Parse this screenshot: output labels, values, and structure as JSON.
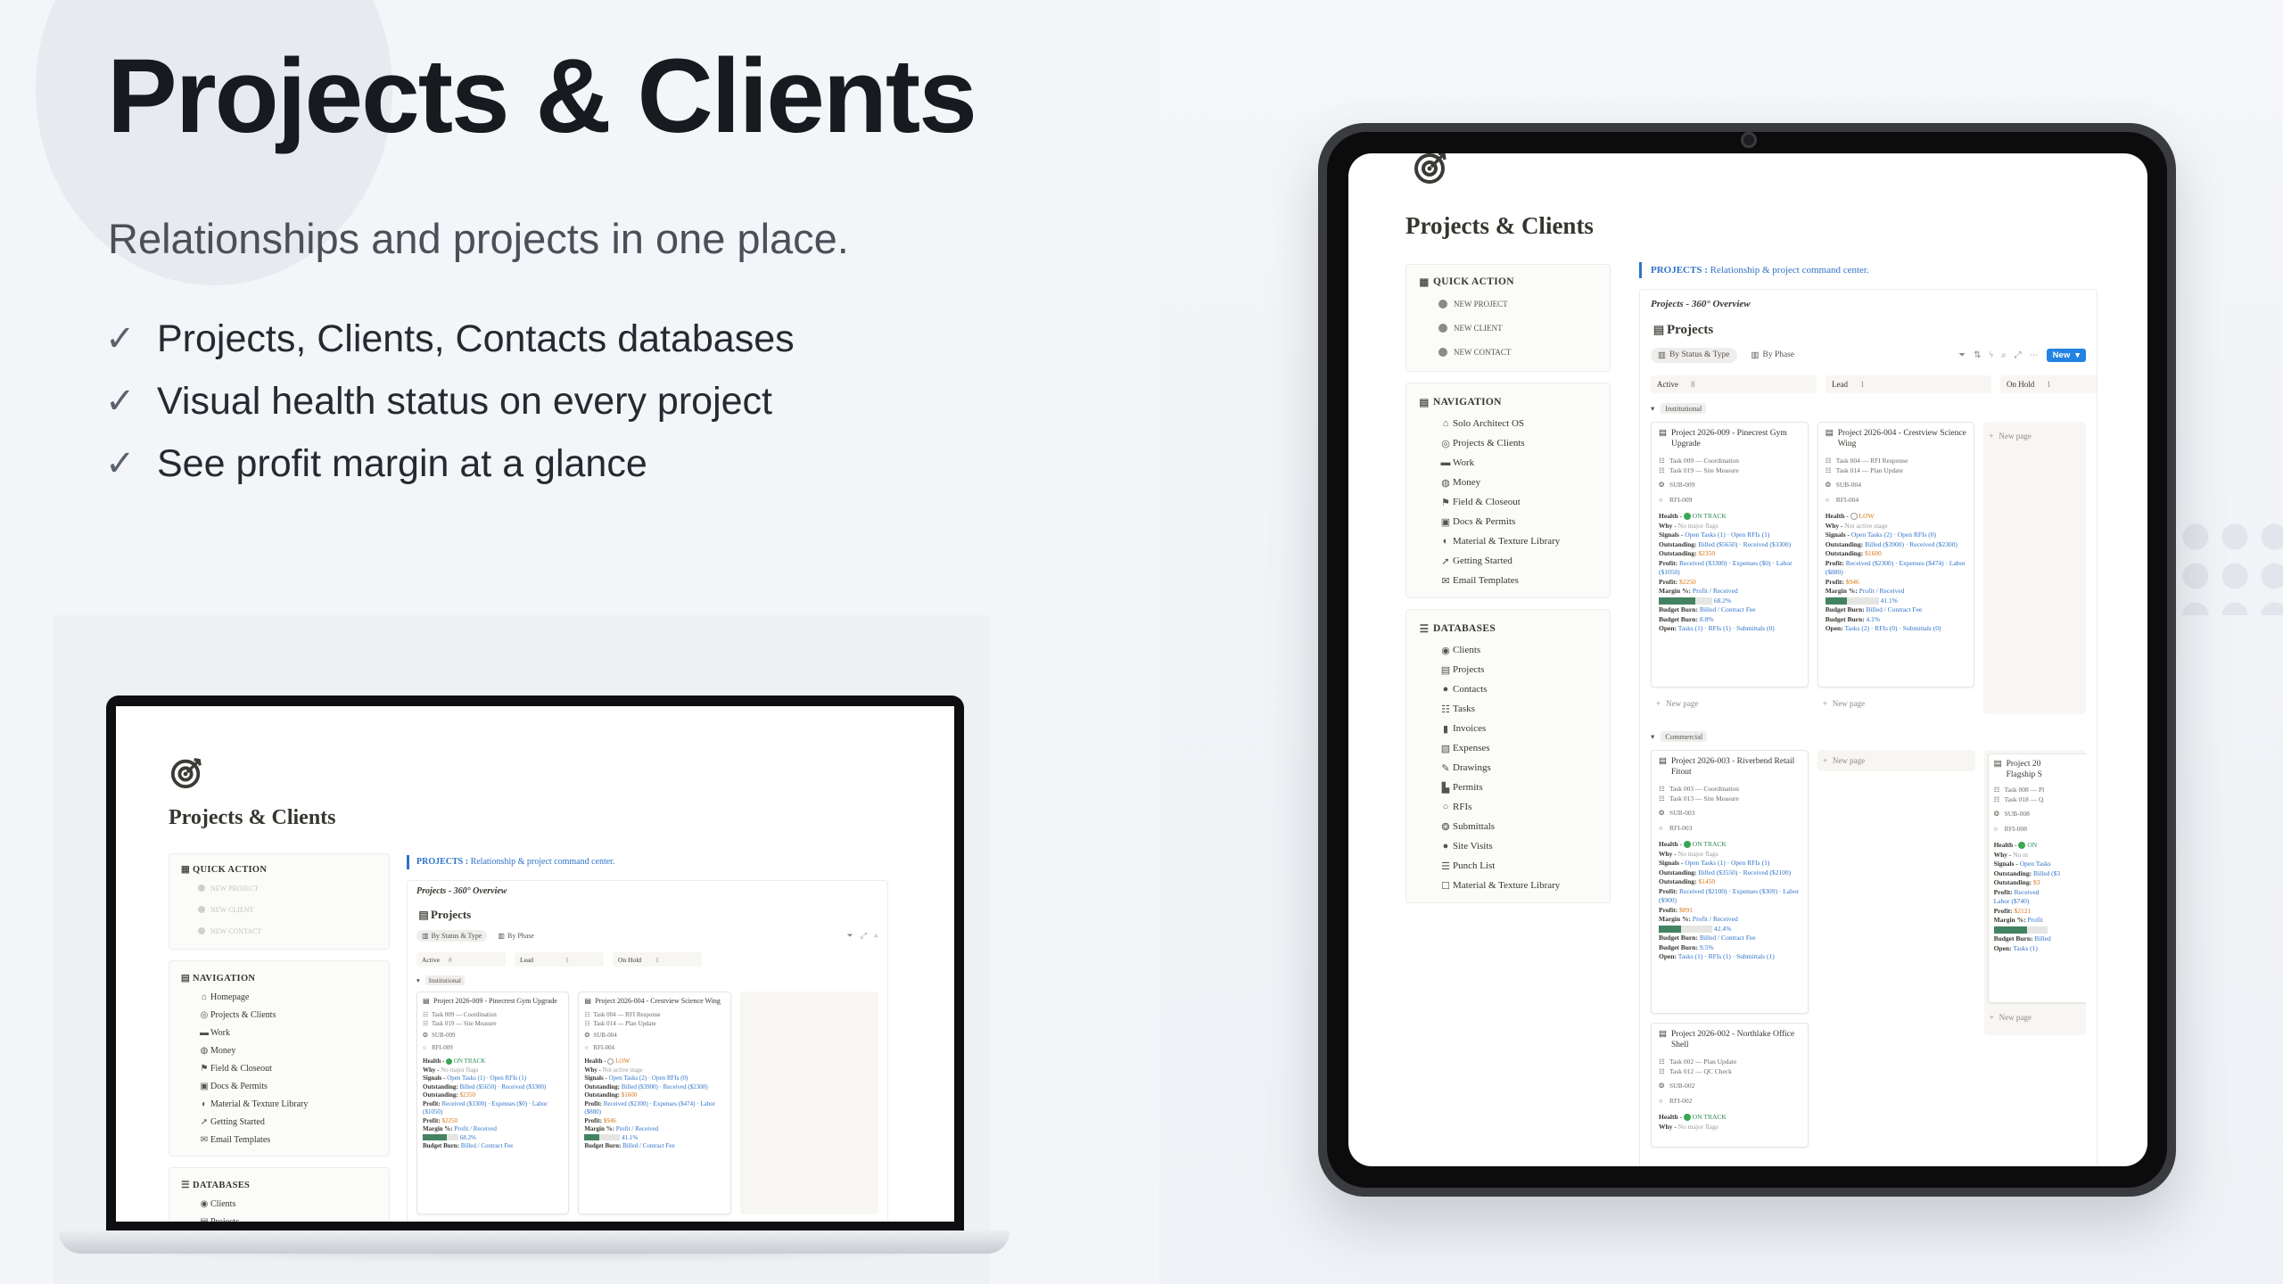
{
  "hero": {
    "title": "Projects & Clients",
    "subtitle": "Relationships and projects in one place.",
    "bullets": [
      "Projects, Clients, Contacts databases",
      "Visual health status on every project",
      "See profit margin at a glance"
    ],
    "check": "✓"
  },
  "app": {
    "page_title": "Projects & Clients",
    "quick_action": {
      "heading": "QUICK ACTION",
      "items": [
        "NEW PROJECT",
        "NEW CLIENT",
        "NEW CONTACT"
      ]
    },
    "navigation": {
      "heading": "NAVIGATION",
      "items_tablet": [
        "Solo Architect OS",
        "Projects & Clients",
        "Work",
        "Money",
        "Field & Closeout",
        "Docs & Permits",
        "Material & Texture Library",
        "Getting Started",
        "Email Templates"
      ],
      "items_laptop": [
        "Homepage",
        "Projects & Clients",
        "Work",
        "Money",
        "Field & Closeout",
        "Docs & Permits",
        "Material & Texture Library",
        "Getting Started",
        "Email Templates"
      ]
    },
    "databases": {
      "heading": "DATABASES",
      "items": [
        "Clients",
        "Projects",
        "Contacts",
        "Tasks",
        "Invoices",
        "Expenses",
        "Drawings",
        "Permits",
        "RFIs",
        "Submittals",
        "Site Visits",
        "Punch List",
        "Material & Texture Library"
      ]
    },
    "banner": {
      "label": "PROJECTS :",
      "text": "Relationship & project command center."
    },
    "overview_title": "Projects - 360° Overview",
    "db_title": "Projects",
    "tabs": [
      "By Status & Type",
      "By Phase"
    ],
    "new_button": "New",
    "columns": [
      {
        "name": "Active",
        "count": "8"
      },
      {
        "name": "Lead",
        "count": "1"
      },
      {
        "name": "On Hold",
        "count": "1"
      }
    ],
    "groups": [
      "Institutional",
      "Commercial"
    ],
    "new_page": "New page",
    "field_labels": {
      "health": "Health -",
      "why": "Why -",
      "signals": "Signals -",
      "outstanding": "Outstanding:",
      "profit": "Profit:",
      "margin": "Margin %:",
      "budget_burn": "Budget Burn:",
      "open": "Open:"
    },
    "cards": [
      {
        "title": "Project 2026-009 - Pinecrest Gym Upgrade",
        "tasks": [
          "Task 009 — Coordination",
          "Task 019 — Site Measure"
        ],
        "sub": "SUB-009",
        "rfi": "RFI-009",
        "health": "ON TRACK",
        "why": "No major flags",
        "signals": "Open Tasks (1) · Open RFIs (1)",
        "outstanding_line": "Billed ($5650) · Received ($3300)",
        "outstanding_value": "$2350",
        "profit_line": "Received ($3300) · Expenses ($0) · Labor ($1050)",
        "profit_value": "$2250",
        "margin_line": "Profit / Received",
        "margin_value": "68.2%",
        "margin_fraction": 0.682,
        "budget_line": "Billed / Contract Fee",
        "budget_value": "8.8%",
        "open_line": "Tasks (1) · RFIs (1) · Submittals (0)"
      },
      {
        "title": "Project 2026-004 - Crestview Science Wing",
        "tasks": [
          "Task 004 — RFI Response",
          "Task 014 — Plan Update"
        ],
        "sub": "SUB-004",
        "rfi": "RFI-004",
        "health": "LOW",
        "why": "Not active stage",
        "signals": "Open Tasks (2) · Open RFIs (0)",
        "outstanding_line": "Billed ($3900) · Received ($2300)",
        "outstanding_value": "$1600",
        "profit_line": "Received ($2300) · Expenses ($474) · Labor ($880)",
        "profit_value": "$946",
        "margin_line": "Profit / Received",
        "margin_value": "41.1%",
        "margin_fraction": 0.411,
        "budget_line": "Billed / Contract Fee",
        "budget_value": "4.1%",
        "open_line": "Tasks (2) · RFIs (0) · Submittals (0)"
      },
      {
        "title": "Project 2026-003 - Riverbend Retail Fitout",
        "tasks": [
          "Task 003 — Coordination",
          "Task 013 — Site Measure"
        ],
        "sub": "SUB-003",
        "rfi": "RFI-003",
        "health": "ON TRACK",
        "why": "No major flags",
        "signals": "Open Tasks (1) · Open RFIs (1)",
        "outstanding_line": "Billed ($3550) · Received ($2100)",
        "outstanding_value": "$1450",
        "profit_line": "Received ($2100) · Expenses ($309) · Labor ($900)",
        "profit_value": "$891",
        "margin_line": "Profit / Received",
        "margin_value": "42.4%",
        "margin_fraction": 0.424,
        "budget_line": "Billed / Contract Fee",
        "budget_value": "9.5%",
        "open_line": "Tasks (1) · RFIs (1) · Submittals (1)"
      },
      {
        "title": "Project 2026-002 - Northlake Office Shell",
        "tasks": [
          "Task 002 — Plan Update",
          "Task 012 — QC Check"
        ],
        "sub": "SUB-002",
        "rfi": "RFI-002",
        "health": "ON TRACK",
        "why": "No major flags"
      },
      {
        "title": "Project 20 Flagship S",
        "tasks": [
          "Task 008 — Pl",
          "Task 018 — Q"
        ],
        "sub": "SUB-008",
        "rfi": "RFI-008",
        "health": "ON",
        "why": "No m",
        "signals": "Open Tasks",
        "outstanding_line": "Billed ($3",
        "outstanding_value": "$3",
        "profit_line": "Received",
        "profit_value": "$2121",
        "margin_line": "Profit",
        "margin_value": "",
        "margin_fraction": 0.62,
        "budget_line": "Billed",
        "budget_value": "",
        "open_line": "Tasks (1)"
      }
    ],
    "partial_labor": "Labor ($740)",
    "colors": {
      "accent": "#2f73c8",
      "new_button": "#2383e2",
      "bar_fill": "#448361",
      "outstanding": "#d9730d",
      "healthy": "#3aa655"
    }
  }
}
